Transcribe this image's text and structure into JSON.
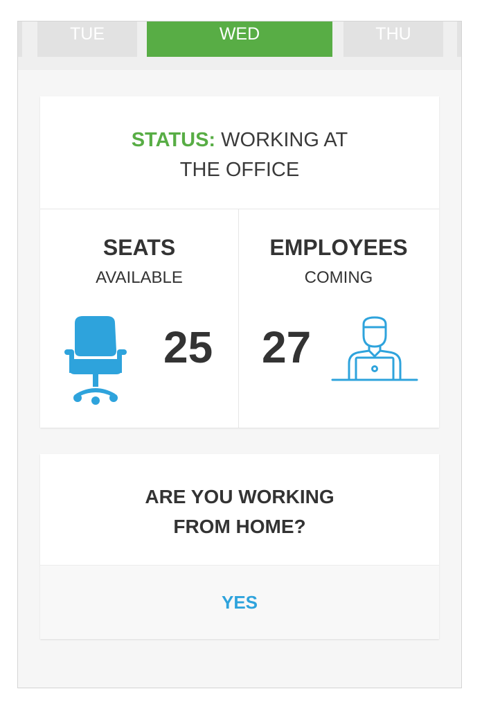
{
  "days": {
    "tue": "TUE",
    "wed": "WED",
    "thu": "THU",
    "active": "WED"
  },
  "status": {
    "label": "STATUS:",
    "value": "WORKING AT THE OFFICE"
  },
  "seats": {
    "title": "SEATS",
    "subtitle": "AVAILABLE",
    "count": "25",
    "icon": "office-chair-icon"
  },
  "employees": {
    "title": "EMPLOYEES",
    "subtitle": "COMING",
    "count": "27",
    "icon": "person-at-laptop-icon"
  },
  "question": {
    "text": "ARE YOU WORKING FROM HOME?",
    "yes_label": "YES"
  },
  "colors": {
    "accent_green": "#58ad45",
    "accent_blue": "#2ea3dc",
    "text_dark": "#333333"
  }
}
